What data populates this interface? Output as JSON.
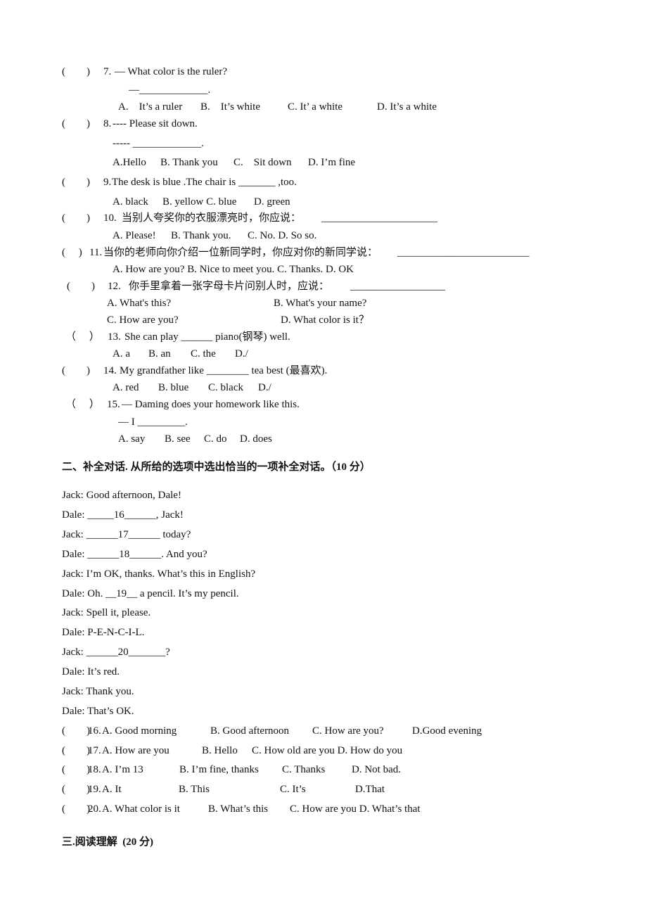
{
  "section1": {
    "questions": [
      {
        "bracket": "(        )",
        "number": "7.",
        "stem": "— What color is the ruler?",
        "answer_line": "—_____________.",
        "options": [
          "A.    It’s a ruler",
          "B.    It’s white",
          "C. It’ a white",
          "D. It’s a white"
        ]
      },
      {
        "bracket": "(        )",
        "number": "8.",
        "stem": "---- Please sit down.",
        "answer_line": "----- _____________.",
        "options": [
          "A.Hello",
          "B. Thank you",
          "C.    Sit down",
          "D. I’m fine"
        ]
      },
      {
        "bracket": "(        )",
        "number": "9.",
        "stem": "The desk is blue .The chair is _______ ,too.",
        "options": [
          "A. black",
          "B. yellow C. blue",
          "D. green"
        ]
      },
      {
        "bracket": "(        )",
        "number": "10.",
        "stem": "当别人夸奖你的衣服漂亮时，你应说：",
        "blank": "______________________",
        "options": [
          "A. Please!",
          "B. Thank you.",
          "C. No. D. So so."
        ]
      },
      {
        "bracket": "(     )",
        "number": "11.",
        "stem": "当你的老师向你介绍一位新同学时，你应对你的新同学说：",
        "blank": "_________________________",
        "options": [
          "A. How are you? B. Nice to meet you. C. Thanks. D. OK"
        ]
      },
      {
        "bracket": "(        )",
        "number": "12.",
        "stem": "你手里拿着一张字母卡片问别人时，应说：",
        "blank": "__________________",
        "options": [
          "A. What's this?",
          "B. What's your name?",
          "C. How are you?",
          "D. What color is it？"
        ]
      },
      {
        "bracket": "（     ）",
        "number": "13.",
        "stem": "She can play ______ piano(钢琴) well.",
        "options": [
          "A. a",
          "B. an",
          "C. the",
          "D./"
        ]
      },
      {
        "bracket": "(        )",
        "number": "14.",
        "stem": "My grandfather like ________ tea best (最喜欢).",
        "options": [
          "A. red",
          "B. blue",
          "C. black",
          "D./"
        ]
      },
      {
        "bracket": "（     ）",
        "number": "15.",
        "stem": "— Daming does your homework like this.",
        "answer_line": "— I _________.",
        "options": [
          "A. say",
          "B. see",
          "C. do",
          "D. does"
        ]
      }
    ]
  },
  "section2": {
    "heading": "二、补全对话. 从所给的选项中选出恰当的一项补全对话。（10 分）",
    "dialogue": [
      "Jack: Good afternoon, Dale!",
      "Dale: _____16______, Jack!",
      "Jack: ______17______ today?",
      "Dale: ______18______. And you?",
      "Jack: I’m OK, thanks. What’s this in English?",
      "Dale: Oh. __19__ a pencil. It’s my pencil.",
      "Jack: Spell it, please.",
      "Dale: P-E-N-C-I-L.",
      "Jack: ______20_______?",
      "Dale: It’s red.",
      "Jack: Thank you.",
      "Dale: That’s OK."
    ],
    "questions": [
      {
        "bracket": "(        )",
        "number": "16.",
        "options": [
          "A. Good morning",
          "B. Good afternoon",
          "C. How are you?",
          "D.Good evening"
        ]
      },
      {
        "bracket": "(        )",
        "number": "17.",
        "options": [
          "A. How are you",
          "B. Hello",
          "C. How old are you D. How do you"
        ]
      },
      {
        "bracket": "(        )",
        "number": "18.",
        "options": [
          "A. I’m 13",
          "B. I’m fine, thanks",
          "C. Thanks",
          "D. Not bad."
        ]
      },
      {
        "bracket": "(        )",
        "number": "19.",
        "options": [
          "A. It",
          "B. This",
          "C. It’s",
          "D.That"
        ]
      },
      {
        "bracket": "(        )",
        "number": "20.",
        "options": [
          "A. What color is it",
          "B. What’s this",
          "C. How are you D. What’s that"
        ]
      }
    ]
  },
  "section3": {
    "heading": "三.阅读理解  (20 分)"
  }
}
